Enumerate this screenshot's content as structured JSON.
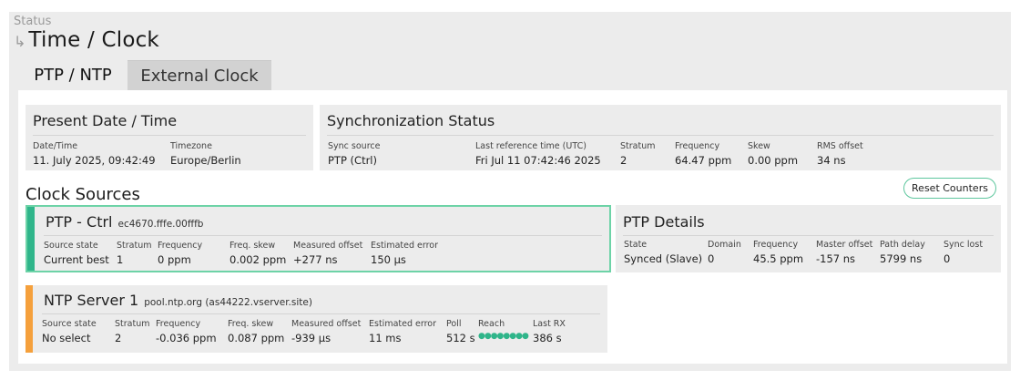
{
  "breadcrumb": "Status",
  "page_title": "Time / Clock",
  "tabs": [
    {
      "label": "PTP / NTP",
      "active": true
    },
    {
      "label": "External Clock",
      "active": false
    }
  ],
  "present_datetime": {
    "title": "Present Date / Time",
    "fields": [
      {
        "label": "Date/Time",
        "value": "11. July 2025, 09:42:49"
      },
      {
        "label": "Timezone",
        "value": "Europe/Berlin"
      }
    ]
  },
  "sync_status": {
    "title": "Synchronization Status",
    "fields": [
      {
        "label": "Sync source",
        "value": "PTP (Ctrl)"
      },
      {
        "label": "Last reference time (UTC)",
        "value": "Fri Jul 11 07:42:46 2025"
      },
      {
        "label": "Stratum",
        "value": "2"
      },
      {
        "label": "Frequency",
        "value": "64.47 ppm"
      },
      {
        "label": "Skew",
        "value": "0.00 ppm"
      },
      {
        "label": "RMS offset",
        "value": "34 ns"
      }
    ]
  },
  "clock_sources": {
    "title": "Clock Sources",
    "reset_label": "Reset Counters",
    "sources": [
      {
        "name": "PTP - Ctrl",
        "address": "ec4670.fffe.00fffb",
        "status_color": "#2fb58a",
        "fields": [
          {
            "label": "Source state",
            "value": "Current best"
          },
          {
            "label": "Stratum",
            "value": "1"
          },
          {
            "label": "Frequency",
            "value": "0 ppm"
          },
          {
            "label": "Freq. skew",
            "value": "0.002 ppm"
          },
          {
            "label": "Measured offset",
            "value": "+277 ns"
          },
          {
            "label": "Estimated error",
            "value": "150 µs"
          }
        ]
      },
      {
        "name": "NTP Server 1",
        "address": "pool.ntp.org (as44222.vserver.site)",
        "status_color": "#f5a03c",
        "fields": [
          {
            "label": "Source state",
            "value": "No select"
          },
          {
            "label": "Stratum",
            "value": "2"
          },
          {
            "label": "Frequency",
            "value": "-0.036 ppm"
          },
          {
            "label": "Freq. skew",
            "value": "0.087 ppm"
          },
          {
            "label": "Measured offset",
            "value": "-939 µs"
          },
          {
            "label": "Estimated error",
            "value": "11 ms"
          },
          {
            "label": "Poll",
            "value": "512 s"
          },
          {
            "label": "Reach",
            "value": "●●●●●●●●"
          },
          {
            "label": "Last RX",
            "value": "386 s"
          }
        ]
      }
    ]
  },
  "ptp_details": {
    "title": "PTP Details",
    "fields": [
      {
        "label": "State",
        "value": "Synced (Slave)"
      },
      {
        "label": "Domain",
        "value": "0"
      },
      {
        "label": "Frequency",
        "value": "45.5 ppm"
      },
      {
        "label": "Master offset",
        "value": "-157 ns"
      },
      {
        "label": "Path delay",
        "value": "5799 ns"
      },
      {
        "label": "Sync lost",
        "value": "0"
      }
    ]
  },
  "colors": {
    "accent_green": "#2fb58a",
    "accent_orange": "#f5a03c",
    "selected_border": "#6dd3a7"
  }
}
